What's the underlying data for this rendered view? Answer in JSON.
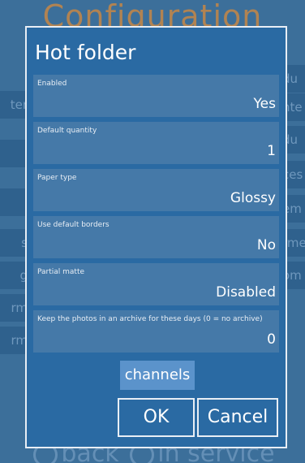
{
  "background": {
    "title": "Configuration",
    "left_items": [
      "ter",
      "",
      "",
      "s",
      "g",
      "rm",
      "rm"
    ],
    "right_items": [
      "du",
      "nte",
      "du",
      "ces",
      "em",
      "rme",
      "om"
    ],
    "back_label": "back",
    "service_label": "in service"
  },
  "dialog": {
    "title": "Hot folder",
    "fields": [
      {
        "label": "Enabled",
        "value": "Yes"
      },
      {
        "label": "Default quantity",
        "value": "1"
      },
      {
        "label": "Paper type",
        "value": "Glossy"
      },
      {
        "label": "Use default borders",
        "value": "No"
      },
      {
        "label": "Partial matte",
        "value": "Disabled"
      },
      {
        "label": "Keep the photos in an archive for these days (0 = no archive)",
        "value": "0"
      }
    ],
    "channels_label": "channels",
    "ok_label": "OK",
    "cancel_label": "Cancel"
  }
}
